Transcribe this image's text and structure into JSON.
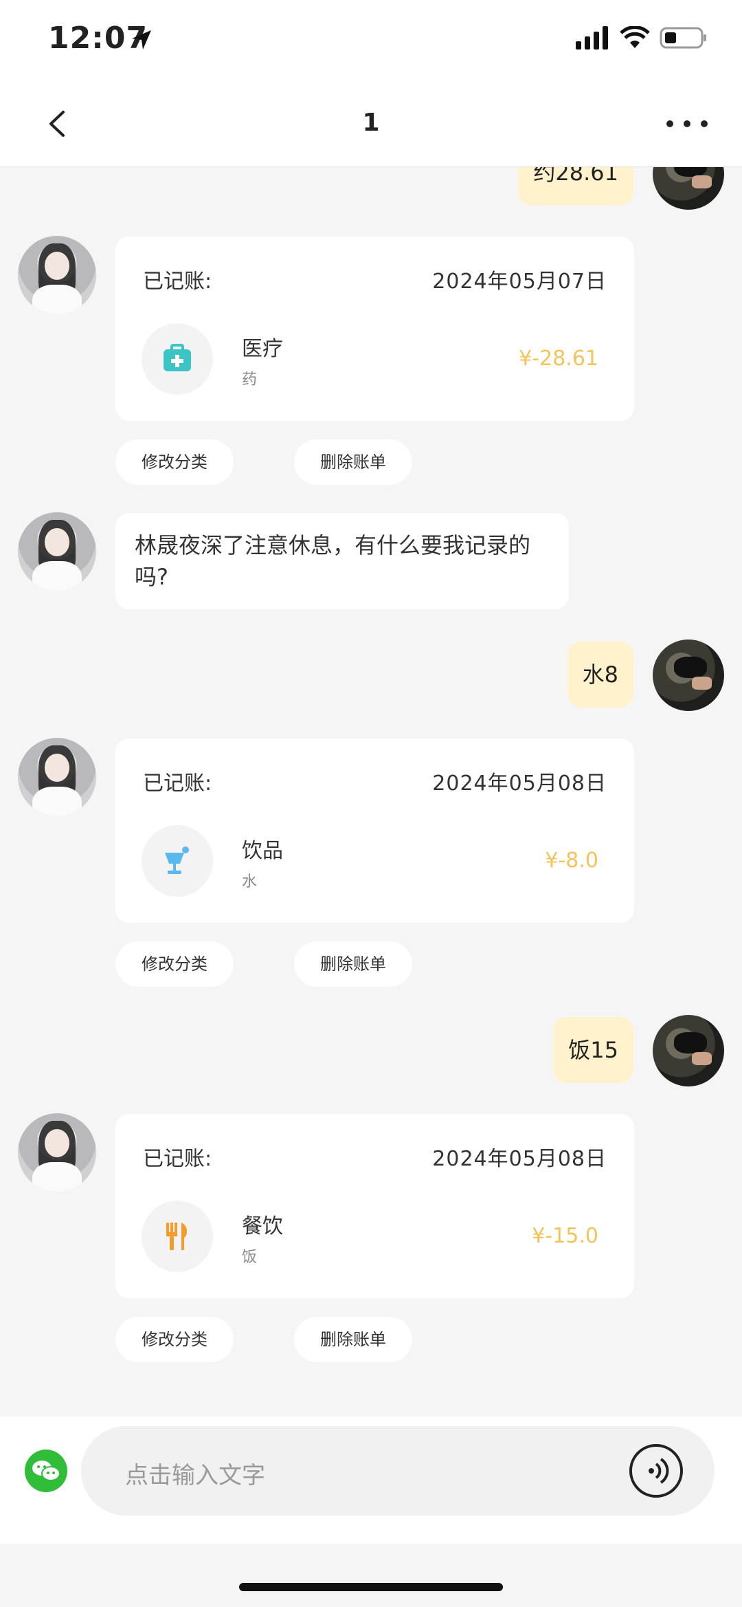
{
  "status": {
    "time": "12:07"
  },
  "nav": {
    "title": "1"
  },
  "messages": {
    "user_1": "约28.61",
    "bot_card_1": {
      "label": "已记账:",
      "date": "2024年05月07日",
      "category": "医疗",
      "note": "药",
      "amount": "¥-28.61",
      "category_icon": "medical-kit-icon"
    },
    "bot_text_1": "林晟夜深了注意休息，有什么要我记录的吗?",
    "user_2": "水8",
    "bot_card_2": {
      "label": "已记账:",
      "date": "2024年05月08日",
      "category": "饮品",
      "note": "水",
      "amount": "¥-8.0",
      "category_icon": "drink-cup-icon"
    },
    "user_3": "饭15",
    "bot_card_3": {
      "label": "已记账:",
      "date": "2024年05月08日",
      "category": "餐饮",
      "note": "饭",
      "amount": "¥-15.0",
      "category_icon": "fork-knife-icon"
    }
  },
  "actions": {
    "edit_category": "修改分类",
    "delete_bill": "删除账单"
  },
  "input": {
    "placeholder": "点击输入文字"
  },
  "colors": {
    "user_bubble": "#fff2cc",
    "amount": "#f5c35a",
    "wechat_green": "#2fbd3a"
  }
}
